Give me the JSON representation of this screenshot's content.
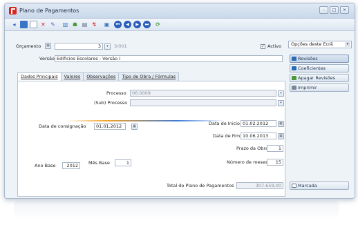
{
  "window": {
    "title": "Plano de Pagamentos",
    "buttons": [
      "–",
      "□",
      "✕"
    ]
  },
  "toolbar": {
    "icons": [
      "back-icon",
      "save-icon",
      "new-document-icon",
      "delete-icon",
      "edit-icon",
      "chart-icon",
      "users-icon",
      "print-icon",
      "export-icon",
      "preview-icon",
      "first-icon",
      "previous-icon",
      "next-icon",
      "last-icon",
      "refresh-icon"
    ]
  },
  "header": {
    "orcamento_label": "Orçamento",
    "orcamento_number": "3",
    "orcamento_ref": "3/001",
    "activo_label": "Activo",
    "activo_checked": true,
    "versao_label": "Versão",
    "versao_value": "Edificios Escolares - Versão I"
  },
  "tabs": [
    "Dados Principais",
    "Valores",
    "Observações",
    "Tipo de Obra / Fórmulas"
  ],
  "form": {
    "processo_label": "Processo",
    "processo_value": "06.0009",
    "subprocesso_label": "(Sub) Processo",
    "subprocesso_value": "",
    "data_consignacao_label": "Data de consignação",
    "data_consignacao_value": "01.01.2012",
    "data_inicio_label": "Data de Inicio",
    "data_inicio_value": "01.02.2012",
    "data_fim_label": "Data de Fim",
    "data_fim_value": "10.06.2013",
    "prazo_label": "Prazo da Obra",
    "prazo_value": "1",
    "ano_base_label": "Ano Base",
    "ano_base_value": "2012",
    "mes_base_label": "Mês Base",
    "mes_base_value": "1",
    "num_meses_label": "Número de meses",
    "num_meses_value": "15",
    "total_label": "Total do Plano de Pagamentos",
    "total_value": "307.659,00"
  },
  "side": {
    "options_label": "Opções deste Ecrã",
    "buttons": [
      "Revisões",
      "Coeficientes",
      "Apagar Revisões",
      "Imprimir"
    ],
    "marcada_label": "Marcada"
  },
  "colors": {
    "accent": "#2a6bb5",
    "app_red": "#d9271e"
  }
}
